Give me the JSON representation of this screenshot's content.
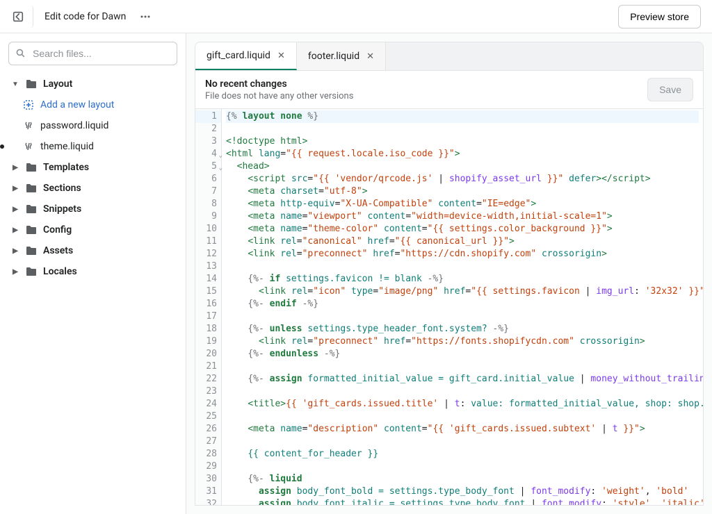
{
  "topbar": {
    "title": "Edit code for Dawn",
    "preview_label": "Preview store"
  },
  "search": {
    "placeholder": "Search files..."
  },
  "sidebar": {
    "folders": [
      {
        "name": "Layout",
        "expanded": true
      },
      {
        "name": "Templates",
        "expanded": false
      },
      {
        "name": "Sections",
        "expanded": false
      },
      {
        "name": "Snippets",
        "expanded": false
      },
      {
        "name": "Config",
        "expanded": false
      },
      {
        "name": "Assets",
        "expanded": false
      },
      {
        "name": "Locales",
        "expanded": false
      }
    ],
    "layout_action": "Add a new layout",
    "layout_files": [
      {
        "name": "password.liquid",
        "modified": false
      },
      {
        "name": "theme.liquid",
        "modified": true
      }
    ]
  },
  "tabs": [
    {
      "label": "gift_card.liquid",
      "active": true
    },
    {
      "label": "footer.liquid",
      "active": false
    }
  ],
  "filebar": {
    "heading": "No recent changes",
    "sub": "File does not have any other versions",
    "save_label": "Save"
  },
  "code": {
    "lines": [
      {
        "n": 1,
        "fold": "",
        "hl": true,
        "tokens": [
          [
            "delim",
            "{% "
          ],
          [
            "kw",
            "layout"
          ],
          [
            "punct",
            " "
          ],
          [
            "kw",
            "none"
          ],
          [
            "delim",
            " %}"
          ]
        ]
      },
      {
        "n": 2,
        "tokens": []
      },
      {
        "n": 3,
        "tokens": [
          [
            "tag",
            "<!doctype html>"
          ]
        ]
      },
      {
        "n": 4,
        "fold": "v",
        "tokens": [
          [
            "tag",
            "<html "
          ],
          [
            "attr",
            "lang"
          ],
          [
            "punct",
            "="
          ],
          [
            "str",
            "\"{{ request.locale.iso_code }}\""
          ],
          [
            "tag",
            ">"
          ]
        ]
      },
      {
        "n": 5,
        "fold": "v",
        "tokens": [
          [
            "punct",
            "  "
          ],
          [
            "tag",
            "<head>"
          ]
        ]
      },
      {
        "n": 6,
        "tokens": [
          [
            "punct",
            "    "
          ],
          [
            "tag",
            "<script "
          ],
          [
            "attr",
            "src"
          ],
          [
            "punct",
            "="
          ],
          [
            "str",
            "\"{{ "
          ],
          [
            "str",
            "'vendor/qrcode.js'"
          ],
          [
            "punct",
            " | "
          ],
          [
            "filter",
            "shopify_asset_url"
          ],
          [
            "str",
            " }}\""
          ],
          [
            "attr",
            " defer"
          ],
          [
            "tag",
            "></script>"
          ]
        ]
      },
      {
        "n": 7,
        "tokens": [
          [
            "punct",
            "    "
          ],
          [
            "tag",
            "<meta "
          ],
          [
            "attr",
            "charset"
          ],
          [
            "punct",
            "="
          ],
          [
            "str",
            "\"utf-8\""
          ],
          [
            "tag",
            ">"
          ]
        ]
      },
      {
        "n": 8,
        "tokens": [
          [
            "punct",
            "    "
          ],
          [
            "tag",
            "<meta "
          ],
          [
            "attr",
            "http-equiv"
          ],
          [
            "punct",
            "="
          ],
          [
            "str",
            "\"X-UA-Compatible\""
          ],
          [
            "punct",
            " "
          ],
          [
            "attr",
            "content"
          ],
          [
            "punct",
            "="
          ],
          [
            "str",
            "\"IE=edge\""
          ],
          [
            "tag",
            ">"
          ]
        ]
      },
      {
        "n": 9,
        "tokens": [
          [
            "punct",
            "    "
          ],
          [
            "tag",
            "<meta "
          ],
          [
            "attr",
            "name"
          ],
          [
            "punct",
            "="
          ],
          [
            "str",
            "\"viewport\""
          ],
          [
            "punct",
            " "
          ],
          [
            "attr",
            "content"
          ],
          [
            "punct",
            "="
          ],
          [
            "str",
            "\"width=device-width,initial-scale=1\""
          ],
          [
            "tag",
            ">"
          ]
        ]
      },
      {
        "n": 10,
        "tokens": [
          [
            "punct",
            "    "
          ],
          [
            "tag",
            "<meta "
          ],
          [
            "attr",
            "name"
          ],
          [
            "punct",
            "="
          ],
          [
            "str",
            "\"theme-color\""
          ],
          [
            "punct",
            " "
          ],
          [
            "attr",
            "content"
          ],
          [
            "punct",
            "="
          ],
          [
            "str",
            "\"{{ settings.color_background }}\""
          ],
          [
            "tag",
            ">"
          ]
        ]
      },
      {
        "n": 11,
        "tokens": [
          [
            "punct",
            "    "
          ],
          [
            "tag",
            "<link "
          ],
          [
            "attr",
            "rel"
          ],
          [
            "punct",
            "="
          ],
          [
            "str",
            "\"canonical\""
          ],
          [
            "punct",
            " "
          ],
          [
            "attr",
            "href"
          ],
          [
            "punct",
            "="
          ],
          [
            "str",
            "\"{{ canonical_url }}\""
          ],
          [
            "tag",
            ">"
          ]
        ]
      },
      {
        "n": 12,
        "tokens": [
          [
            "punct",
            "    "
          ],
          [
            "tag",
            "<link "
          ],
          [
            "attr",
            "rel"
          ],
          [
            "punct",
            "="
          ],
          [
            "str",
            "\"preconnect\""
          ],
          [
            "punct",
            " "
          ],
          [
            "attr",
            "href"
          ],
          [
            "punct",
            "="
          ],
          [
            "str",
            "\"https://cdn.shopify.com\""
          ],
          [
            "attr",
            " crossorigin"
          ],
          [
            "tag",
            ">"
          ]
        ]
      },
      {
        "n": 13,
        "tokens": []
      },
      {
        "n": 14,
        "tokens": [
          [
            "punct",
            "    "
          ],
          [
            "delim",
            "{%- "
          ],
          [
            "kw",
            "if"
          ],
          [
            "var",
            " settings.favicon != blank "
          ],
          [
            "delim",
            "-%}"
          ]
        ]
      },
      {
        "n": 15,
        "tokens": [
          [
            "punct",
            "      "
          ],
          [
            "tag",
            "<link "
          ],
          [
            "attr",
            "rel"
          ],
          [
            "punct",
            "="
          ],
          [
            "str",
            "\"icon\""
          ],
          [
            "punct",
            " "
          ],
          [
            "attr",
            "type"
          ],
          [
            "punct",
            "="
          ],
          [
            "str",
            "\"image/png\""
          ],
          [
            "punct",
            " "
          ],
          [
            "attr",
            "href"
          ],
          [
            "punct",
            "="
          ],
          [
            "str",
            "\"{{ settings.favicon "
          ],
          [
            "punct",
            "| "
          ],
          [
            "filter",
            "img_url"
          ],
          [
            "punct",
            ": "
          ],
          [
            "str",
            "'32x32'"
          ],
          [
            "str",
            " }}\""
          ],
          [
            "tag",
            ">"
          ]
        ]
      },
      {
        "n": 16,
        "tokens": [
          [
            "punct",
            "    "
          ],
          [
            "delim",
            "{%- "
          ],
          [
            "kw",
            "endif"
          ],
          [
            "delim",
            " -%}"
          ]
        ]
      },
      {
        "n": 17,
        "tokens": []
      },
      {
        "n": 18,
        "tokens": [
          [
            "punct",
            "    "
          ],
          [
            "delim",
            "{%- "
          ],
          [
            "kw",
            "unless"
          ],
          [
            "var",
            " settings.type_header_font.system? "
          ],
          [
            "delim",
            "-%}"
          ]
        ]
      },
      {
        "n": 19,
        "tokens": [
          [
            "punct",
            "      "
          ],
          [
            "tag",
            "<link "
          ],
          [
            "attr",
            "rel"
          ],
          [
            "punct",
            "="
          ],
          [
            "str",
            "\"preconnect\""
          ],
          [
            "punct",
            " "
          ],
          [
            "attr",
            "href"
          ],
          [
            "punct",
            "="
          ],
          [
            "str",
            "\"https://fonts.shopifycdn.com\""
          ],
          [
            "attr",
            " crossorigin"
          ],
          [
            "tag",
            ">"
          ]
        ]
      },
      {
        "n": 20,
        "tokens": [
          [
            "punct",
            "    "
          ],
          [
            "delim",
            "{%- "
          ],
          [
            "kw",
            "endunless"
          ],
          [
            "delim",
            " -%}"
          ]
        ]
      },
      {
        "n": 21,
        "tokens": []
      },
      {
        "n": 22,
        "tokens": [
          [
            "punct",
            "    "
          ],
          [
            "delim",
            "{%- "
          ],
          [
            "kw",
            "assign"
          ],
          [
            "var",
            " formatted_initial_value = gift_card.initial_value "
          ],
          [
            "punct",
            "| "
          ],
          [
            "filter",
            "money_without_trailing_ze"
          ]
        ]
      },
      {
        "n": 23,
        "tokens": []
      },
      {
        "n": 24,
        "tokens": [
          [
            "punct",
            "    "
          ],
          [
            "tag",
            "<title>"
          ],
          [
            "str",
            "{{ 'gift_cards.issued.title'"
          ],
          [
            "punct",
            " | "
          ],
          [
            "filter",
            "t"
          ],
          [
            "punct",
            ": "
          ],
          [
            "var",
            "value: formatted_initial_value, shop: shop.nam"
          ]
        ]
      },
      {
        "n": 25,
        "tokens": []
      },
      {
        "n": 26,
        "tokens": [
          [
            "punct",
            "    "
          ],
          [
            "tag",
            "<meta "
          ],
          [
            "attr",
            "name"
          ],
          [
            "punct",
            "="
          ],
          [
            "str",
            "\"description\""
          ],
          [
            "punct",
            " "
          ],
          [
            "attr",
            "content"
          ],
          [
            "punct",
            "="
          ],
          [
            "str",
            "\"{{ 'gift_cards.issued.subtext'"
          ],
          [
            "punct",
            " | "
          ],
          [
            "filter",
            "t"
          ],
          [
            "str",
            " }}\""
          ],
          [
            "tag",
            ">"
          ]
        ]
      },
      {
        "n": 27,
        "tokens": []
      },
      {
        "n": 28,
        "tokens": [
          [
            "punct",
            "    "
          ],
          [
            "var",
            "{{ content_for_header }}"
          ]
        ]
      },
      {
        "n": 29,
        "tokens": []
      },
      {
        "n": 30,
        "tokens": [
          [
            "punct",
            "    "
          ],
          [
            "delim",
            "{%- "
          ],
          [
            "kw",
            "liquid"
          ]
        ]
      },
      {
        "n": 31,
        "tokens": [
          [
            "punct",
            "      "
          ],
          [
            "kw",
            "assign"
          ],
          [
            "var",
            " body_font_bold = settings.type_body_font "
          ],
          [
            "punct",
            "| "
          ],
          [
            "filter",
            "font_modify"
          ],
          [
            "punct",
            ": "
          ],
          [
            "str",
            "'weight'"
          ],
          [
            "punct",
            ", "
          ],
          [
            "str",
            "'bold'"
          ]
        ]
      },
      {
        "n": 32,
        "tokens": [
          [
            "punct",
            "      "
          ],
          [
            "kw",
            "assign"
          ],
          [
            "var",
            " body_font_italic = settings.type_body_font "
          ],
          [
            "punct",
            "| "
          ],
          [
            "filter",
            "font_modify"
          ],
          [
            "punct",
            ": "
          ],
          [
            "str",
            "'style'"
          ],
          [
            "punct",
            ", "
          ],
          [
            "str",
            "'italic'"
          ]
        ]
      }
    ]
  }
}
